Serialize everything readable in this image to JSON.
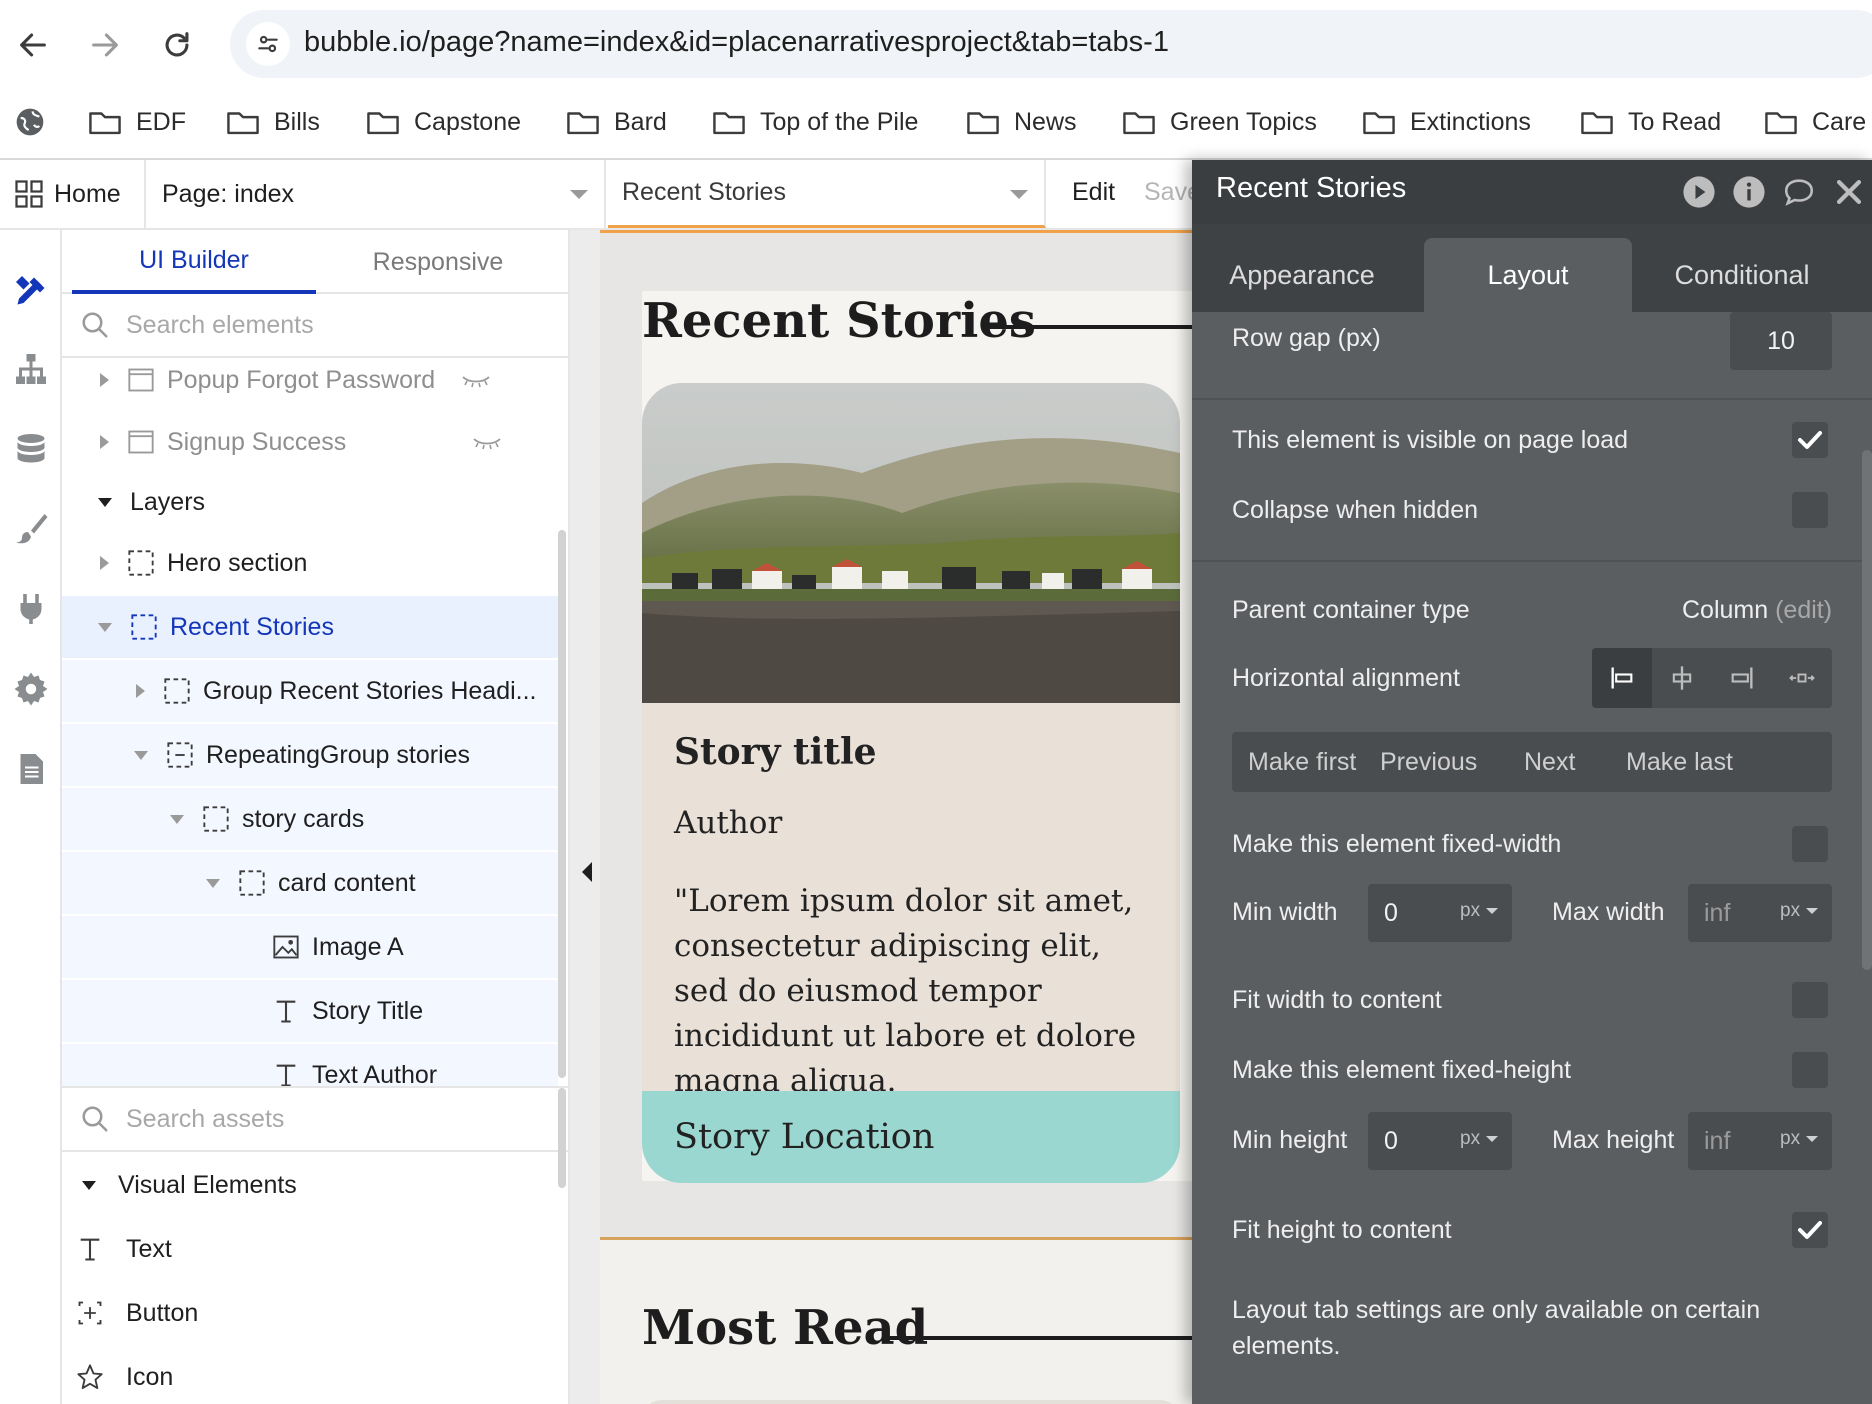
{
  "browser": {
    "url": "bubble.io/page?name=index&id=placenarrativesproject&tab=tabs-1",
    "bookmarks": [
      "EDF",
      "Bills",
      "Capstone",
      "Bard",
      "Top of the Pile",
      "News",
      "Green Topics",
      "Extinctions",
      "To Read",
      "Care"
    ]
  },
  "topbar": {
    "home": "Home",
    "page_select": "Page: index",
    "element_select": "Recent Stories",
    "edit": "Edit",
    "save": "Save"
  },
  "rail": {
    "icons": [
      "design-icon",
      "workflow-icon",
      "data-icon",
      "styles-icon",
      "plugins-icon",
      "settings-icon",
      "logs-icon"
    ]
  },
  "panel": {
    "tabs": [
      "UI Builder",
      "Responsive"
    ],
    "search_placeholder": "Search elements",
    "tree": [
      {
        "label": "Popup Forgot Password",
        "hidden": true
      },
      {
        "label": "Signup Success",
        "hidden": true
      },
      {
        "label": "Layers"
      },
      {
        "label": "Hero section"
      },
      {
        "label": "Recent Stories",
        "selected": true
      },
      {
        "label": "Group Recent Stories Headi..."
      },
      {
        "label": "RepeatingGroup stories"
      },
      {
        "label": "story cards"
      },
      {
        "label": "card content"
      },
      {
        "label": "Image A"
      },
      {
        "label": "Story Title"
      },
      {
        "label": "Text Author"
      }
    ],
    "assets_placeholder": "Search assets",
    "visual_elements_header": "Visual Elements",
    "assets": [
      "Text",
      "Button",
      "Icon"
    ]
  },
  "canvas": {
    "recent_heading": "Recent Stories",
    "card": {
      "title": "Story title",
      "author": "Author",
      "body": "\"Lorem ipsum dolor sit amet, consectetur adipiscing elit, sed do eiusmod tempor incididunt ut labore et dolore magna aliqua.",
      "location": "Story Location"
    },
    "most_read_heading": "Most Read"
  },
  "editor": {
    "title": "Recent Stories",
    "tabs": [
      "Appearance",
      "Layout",
      "Conditional"
    ],
    "active_tab": "Layout",
    "row_gap_label": "Row gap (px)",
    "row_gap_value": "10",
    "visible_on_load_label": "This element is visible on page load",
    "visible_on_load": true,
    "collapse_hidden_label": "Collapse when hidden",
    "collapse_hidden": false,
    "parent_type_label": "Parent container type",
    "parent_type_value": "Column",
    "parent_type_edit": "(edit)",
    "h_align_label": "Horizontal alignment",
    "order_buttons": [
      "Make first",
      "Previous",
      "Next",
      "Make last"
    ],
    "fixed_width_label": "Make this element fixed-width",
    "fixed_width": false,
    "min_width_label": "Min width",
    "min_width_value": "0",
    "max_width_label": "Max width",
    "max_width_placeholder": "inf",
    "unit": "px",
    "fit_width_label": "Fit width to content",
    "fit_width": false,
    "fixed_height_label": "Make this element fixed-height",
    "fixed_height": false,
    "min_height_label": "Min height",
    "min_height_value": "0",
    "max_height_label": "Max height",
    "max_height_placeholder": "inf",
    "fit_height_label": "Fit height to content",
    "fit_height": true,
    "note_line1": "Layout tab settings are only available on certain",
    "note_line2": "elements."
  },
  "colors": {
    "accent_blue": "#1436b8",
    "editor_bg": "#5b5e61",
    "location_teal": "#9bd7d1",
    "selection_orange": "#f0a24a"
  }
}
